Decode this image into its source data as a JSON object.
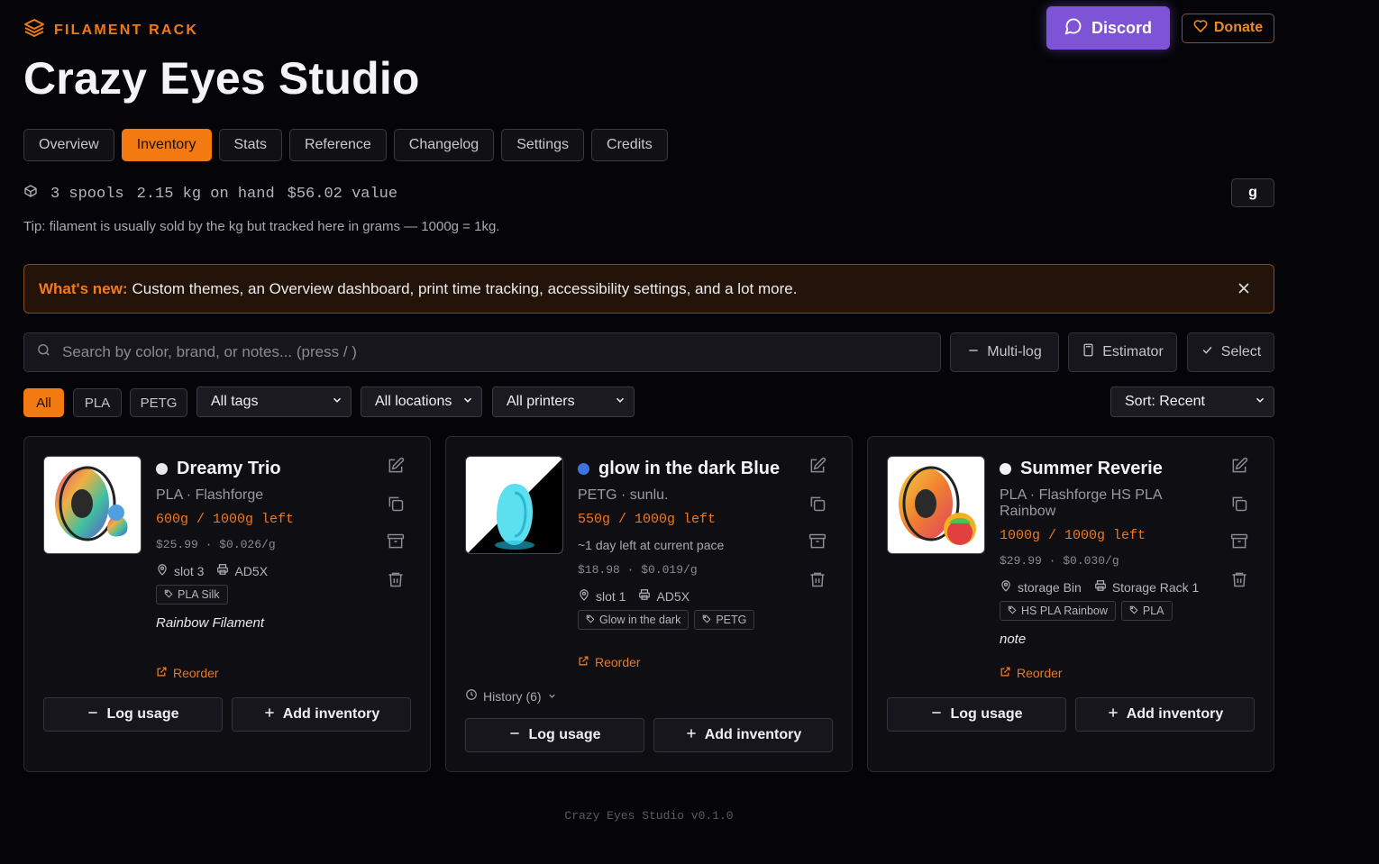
{
  "brand": "FILAMENT RACK",
  "discord_label": "Discord",
  "donate_label": "Donate",
  "studio_title": "Crazy Eyes Studio",
  "tabs": [
    {
      "label": "Overview",
      "active": false
    },
    {
      "label": "Inventory",
      "active": true
    },
    {
      "label": "Stats",
      "active": false
    },
    {
      "label": "Reference",
      "active": false
    },
    {
      "label": "Changelog",
      "active": false
    },
    {
      "label": "Settings",
      "active": false
    },
    {
      "label": "Credits",
      "active": false
    }
  ],
  "stats": {
    "spools": "3 spools",
    "on_hand": "2.15 kg on hand",
    "value": "$56.02 value"
  },
  "unit_label": "g",
  "tip": "Tip: filament is usually sold by the kg but tracked here in grams — 1000g = 1kg.",
  "news": {
    "label": "What's new:",
    "text": "Custom themes, an Overview dashboard, print time tracking, accessibility settings, and a lot more."
  },
  "search": {
    "placeholder": "Search by color, brand, or notes... (press / )"
  },
  "actions": {
    "multilog": "Multi-log",
    "estimator": "Estimator",
    "select": "Select"
  },
  "filters": {
    "materials": [
      "All",
      "PLA",
      "PETG"
    ],
    "tags": "All tags",
    "locations": "All locations",
    "printers": "All printers",
    "sort": "Sort: Recent"
  },
  "cards": [
    {
      "name": "Dreamy Trio",
      "color": "#e8e8ec",
      "sub": "PLA · Flashforge",
      "left": "600g / 1000g left",
      "price": "$25.99 · $0.026/g",
      "slot": "slot 3",
      "printer": "AD5X",
      "tags": [
        "PLA Silk"
      ],
      "note": "Rainbow Filament",
      "reorder": "Reorder",
      "log": "Log usage",
      "add": "Add inventory"
    },
    {
      "name": "glow in the dark Blue",
      "color": "#3d74e0",
      "sub": "PETG · sunlu.",
      "left": "550g / 1000g left",
      "eta": "~1 day left at current pace",
      "price": "$18.98 · $0.019/g",
      "slot": "slot 1",
      "printer": "AD5X",
      "tags": [
        "Glow in the dark",
        "PETG"
      ],
      "reorder": "Reorder",
      "history": "History (6)",
      "log": "Log usage",
      "add": "Add inventory"
    },
    {
      "name": "Summer Reverie",
      "color": "#f2f2f6",
      "sub": "PLA · Flashforge HS PLA Rainbow",
      "left": "1000g / 1000g left",
      "price": "$29.99 · $0.030/g",
      "slot": "storage Bin",
      "printer": "Storage Rack 1",
      "tags": [
        "HS PLA Rainbow",
        "PLA"
      ],
      "note": "note",
      "reorder": "Reorder",
      "log": "Log usage",
      "add": "Add inventory"
    }
  ],
  "footer": "Crazy Eyes Studio v0.1.0"
}
